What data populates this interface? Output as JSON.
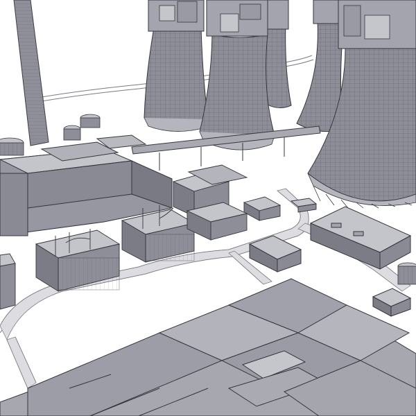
{
  "scene": {
    "subject": "power-plant-wireframe-render",
    "palette": {
      "background": "#ffffff",
      "model_fill": "#9b9ba5",
      "model_light": "#c9c9d0",
      "model_dark": "#6f6f79",
      "wire": "#3c3c44",
      "road": "#d9d9de"
    },
    "elements": {
      "cooling_towers": 5,
      "chimney_stacks": 1,
      "storage_tanks": 4
    }
  }
}
